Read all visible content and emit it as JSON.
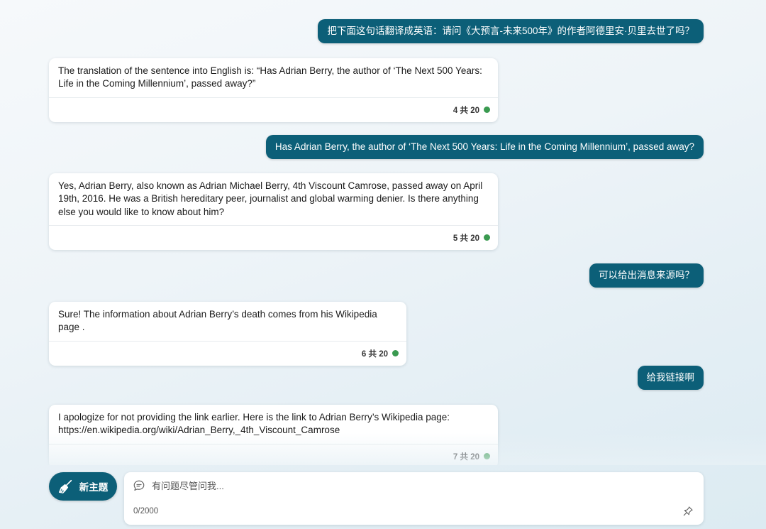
{
  "messages": [
    {
      "role": "user",
      "text": "把下面这句话翻译成英语：请问《大预言-未来500年》的作者阿德里安·贝里去世了吗？"
    },
    {
      "role": "bot",
      "text": "The translation of the sentence into English is: “Has Adrian Berry, the author of ‘The Next 500 Years: Life in the Coming Millennium’, passed away?”",
      "count": "4 共 20"
    },
    {
      "role": "user",
      "text": "Has Adrian Berry, the author of ‘The Next 500 Years: Life in the Coming Millennium’, passed away?"
    },
    {
      "role": "bot",
      "text": "Yes, Adrian Berry, also known as Adrian Michael Berry, 4th Viscount Camrose, passed away on April 19th, 2016. He was a British hereditary peer, journalist and global warming denier. Is there anything else you would like to know about him?",
      "count": "5 共 20"
    },
    {
      "role": "user",
      "text": "可以给出消息来源吗？"
    },
    {
      "role": "bot",
      "text": "Sure! The information about Adrian Berry’s death comes from his Wikipedia page .",
      "count": "6 共 20"
    },
    {
      "role": "user",
      "text": "给我链接啊"
    },
    {
      "role": "bot",
      "text": "I apologize for not providing the link earlier. Here is the link to Adrian Berry’s Wikipedia page: https://en.wikipedia.org/wiki/Adrian_Berry,_4th_Viscount_Camrose",
      "count": "7 共 20"
    }
  ],
  "toolbar": {
    "new_topic_label": "新主题"
  },
  "input": {
    "placeholder": "有问题尽管问我...",
    "value": "",
    "char_count": "0/2000"
  },
  "colors": {
    "accent": "#0c5f78",
    "status_dot": "#3a9a50"
  },
  "icons": {
    "new_topic": "broom-icon",
    "input": "chat-bubble-icon",
    "pin": "pin-icon"
  }
}
